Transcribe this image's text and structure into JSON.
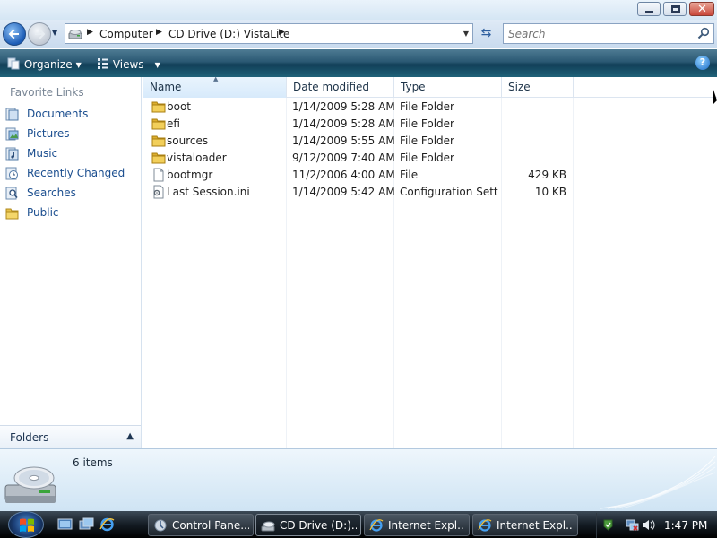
{
  "window": {
    "caption_buttons": [
      "minimize-icon",
      "maximize-icon",
      "close-icon"
    ]
  },
  "address_bar": {
    "breadcrumbs": [
      "Computer",
      "CD Drive (D:) VistaLite"
    ],
    "search_placeholder": "Search"
  },
  "toolbar": {
    "organize_label": "Organize",
    "views_label": "Views",
    "help_icon": "help-icon"
  },
  "nav_pane": {
    "header": "Favorite Links",
    "items": [
      {
        "label": "Documents",
        "icon": "documents-icon"
      },
      {
        "label": "Pictures",
        "icon": "pictures-icon"
      },
      {
        "label": "Music",
        "icon": "music-icon"
      },
      {
        "label": "Recently Changed",
        "icon": "recently-changed-icon"
      },
      {
        "label": "Searches",
        "icon": "searches-icon"
      },
      {
        "label": "Public",
        "icon": "public-folder-icon"
      }
    ],
    "folders_label": "Folders"
  },
  "file_list": {
    "columns": [
      "Name",
      "Date modified",
      "Type",
      "Size"
    ],
    "rows": [
      {
        "name": "boot",
        "date": "1/14/2009 5:28 AM",
        "type": "File Folder",
        "size": "",
        "icon": "folder-icon"
      },
      {
        "name": "efi",
        "date": "1/14/2009 5:28 AM",
        "type": "File Folder",
        "size": "",
        "icon": "folder-icon"
      },
      {
        "name": "sources",
        "date": "1/14/2009 5:55 AM",
        "type": "File Folder",
        "size": "",
        "icon": "folder-icon"
      },
      {
        "name": "vistaloader",
        "date": "9/12/2009 7:40 AM",
        "type": "File Folder",
        "size": "",
        "icon": "folder-icon"
      },
      {
        "name": "bootmgr",
        "date": "11/2/2006 4:00 AM",
        "type": "File",
        "size": "429 KB",
        "icon": "file-icon"
      },
      {
        "name": "Last Session.ini",
        "date": "1/14/2009 5:42 AM",
        "type": "Configuration Sett...",
        "size": "10 KB",
        "icon": "config-file-icon"
      }
    ]
  },
  "details_pane": {
    "item_count": "6 items",
    "icon": "cd-drive-icon"
  },
  "taskbar": {
    "tasks": [
      {
        "label": "Control Pane...",
        "icon": "control-panel-icon",
        "active": false
      },
      {
        "label": "CD Drive (D:)...",
        "icon": "cd-drive-icon",
        "active": true
      },
      {
        "label": "Internet Expl...",
        "icon": "internet-explorer-icon",
        "active": false
      },
      {
        "label": "Internet Expl...",
        "icon": "internet-explorer-icon",
        "active": false
      }
    ],
    "clock": "1:47 PM"
  },
  "colors": {
    "link": "#1b4e8f",
    "toolbar": "#1f5570",
    "taskbar": "#141c24"
  }
}
